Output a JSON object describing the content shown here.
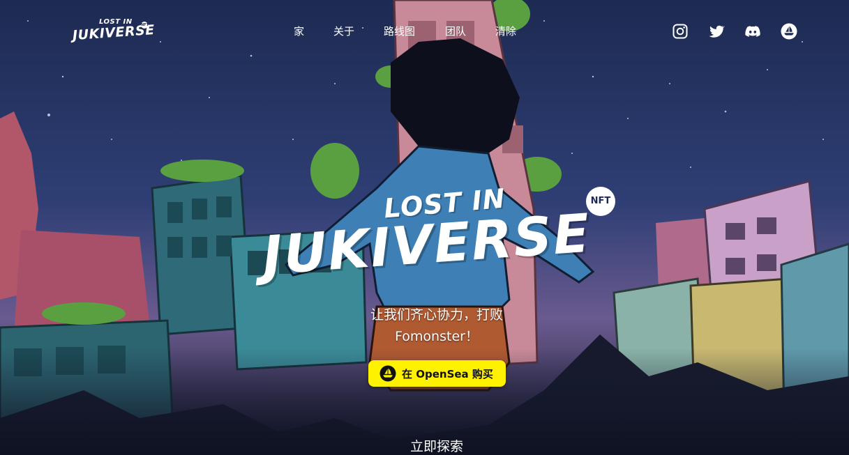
{
  "brand": {
    "logo_small": "LOST IN",
    "logo_big": "JUKIVERSE",
    "logo_badge": "NFT"
  },
  "nav": {
    "items": [
      "家",
      "关于",
      "路线图",
      "团队",
      "清除"
    ]
  },
  "social": {
    "icons": [
      "instagram-icon",
      "twitter-icon",
      "discord-icon",
      "opensea-icon"
    ]
  },
  "hero": {
    "title_small": "LOST IN",
    "title_big": "JUKIVERSE",
    "title_badge": "NFT",
    "tagline_line1": "让我们齐心协力，打败",
    "tagline_line2": "Fomonster！",
    "buy_button": "在 OpenSea 购买",
    "explore": "立即探索"
  },
  "colors": {
    "accent_button": "#fff200",
    "text": "#ffffff",
    "sky": "#1d2a55"
  }
}
